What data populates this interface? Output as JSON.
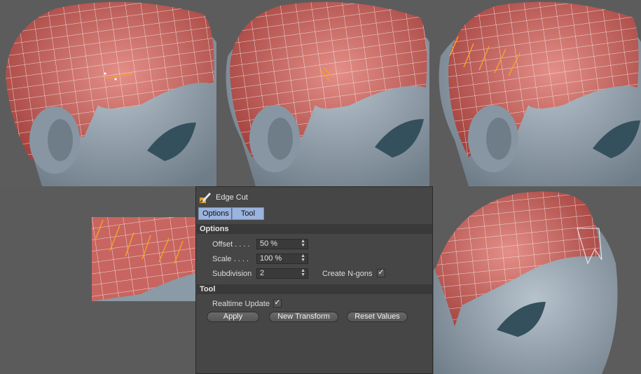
{
  "panel": {
    "title": "Edge Cut",
    "tabs": [
      "Options",
      "Tool"
    ],
    "options_header": "Options",
    "offset_label": "Offset . . . .",
    "offset_value": "50 %",
    "scale_label": "Scale . . . .",
    "scale_value": "100 %",
    "subdivision_label": "Subdivision",
    "subdivision_value": "2",
    "create_ngons_label": "Create N-gons",
    "create_ngons_checked": true,
    "tool_header": "Tool",
    "realtime_update_label": "Realtime Update",
    "realtime_update_checked": true,
    "apply_label": "Apply",
    "new_transform_label": "New Transform",
    "reset_values_label": "Reset Values",
    "check_mark": "✓"
  },
  "colors": {
    "viewport_bg": "#5c5c5c",
    "hair": "#c25e5a",
    "skin": "#8e9ca9",
    "wire": "#f2ecec",
    "highlight_edge": "#f2a22a",
    "panel_bg": "#464646",
    "tab_active": "#9bb4de"
  }
}
